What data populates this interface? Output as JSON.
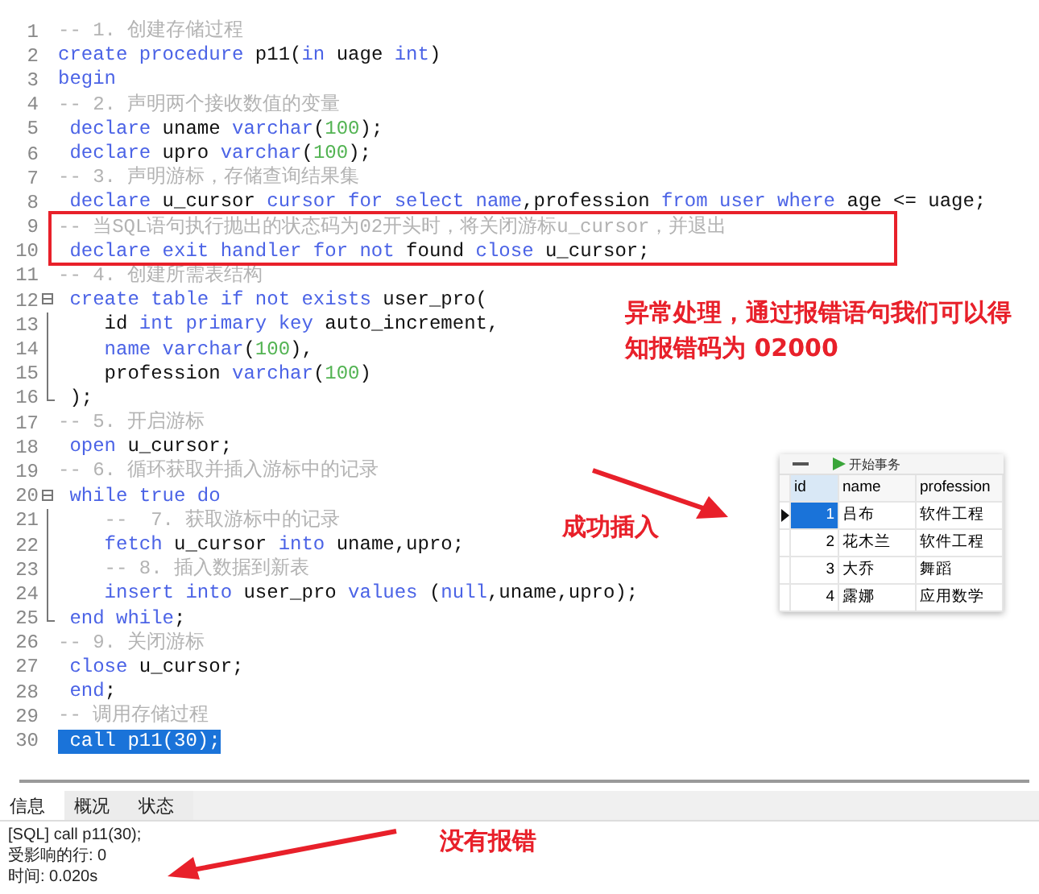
{
  "editor": {
    "lines": [
      {
        "number": "1",
        "selected": false,
        "tokens": [
          {
            "kind": "comment",
            "text": "-- 1. 创建存储过程"
          }
        ]
      },
      {
        "number": "2",
        "selected": false,
        "tokens": [
          {
            "kind": "keyword",
            "text": "create procedure"
          },
          {
            "kind": "plain",
            "text": " p11("
          },
          {
            "kind": "keyword",
            "text": "in"
          },
          {
            "kind": "plain",
            "text": " uage "
          },
          {
            "kind": "keyword",
            "text": "int"
          },
          {
            "kind": "plain",
            "text": ")"
          }
        ]
      },
      {
        "number": "3",
        "selected": false,
        "tokens": [
          {
            "kind": "keyword",
            "text": "begin"
          }
        ]
      },
      {
        "number": "4",
        "selected": false,
        "tokens": [
          {
            "kind": "comment",
            "text": "-- 2. 声明两个接收数值的变量"
          }
        ]
      },
      {
        "number": "5",
        "selected": false,
        "tokens": [
          {
            "kind": "keyword",
            "text": " declare"
          },
          {
            "kind": "plain",
            "text": " uname "
          },
          {
            "kind": "keyword",
            "text": "varchar"
          },
          {
            "kind": "plain",
            "text": "("
          },
          {
            "kind": "number",
            "text": "100"
          },
          {
            "kind": "plain",
            "text": ");"
          }
        ]
      },
      {
        "number": "6",
        "selected": false,
        "tokens": [
          {
            "kind": "keyword",
            "text": " declare"
          },
          {
            "kind": "plain",
            "text": " upro "
          },
          {
            "kind": "keyword",
            "text": "varchar"
          },
          {
            "kind": "plain",
            "text": "("
          },
          {
            "kind": "number",
            "text": "100"
          },
          {
            "kind": "plain",
            "text": ");"
          }
        ]
      },
      {
        "number": "7",
        "selected": false,
        "tokens": [
          {
            "kind": "comment",
            "text": "-- 3. 声明游标，存储查询结果集"
          }
        ]
      },
      {
        "number": "8",
        "selected": false,
        "tokens": [
          {
            "kind": "keyword",
            "text": " declare"
          },
          {
            "kind": "plain",
            "text": " u_cursor "
          },
          {
            "kind": "keyword",
            "text": "cursor for select name"
          },
          {
            "kind": "plain",
            "text": ",profession "
          },
          {
            "kind": "keyword",
            "text": "from user where"
          },
          {
            "kind": "plain",
            "text": " age <= uage;"
          }
        ]
      },
      {
        "number": "9",
        "selected": false,
        "tokens": [
          {
            "kind": "comment",
            "text": "-- 当SQL语句执行抛出的状态码为02开头时，将关闭游标u_cursor，并退出"
          }
        ]
      },
      {
        "number": "10",
        "selected": false,
        "tokens": [
          {
            "kind": "keyword",
            "text": " declare exit handler for not"
          },
          {
            "kind": "plain",
            "text": " found "
          },
          {
            "kind": "keyword",
            "text": "close"
          },
          {
            "kind": "plain",
            "text": " u_cursor;"
          }
        ]
      },
      {
        "number": "11",
        "selected": false,
        "tokens": [
          {
            "kind": "comment",
            "text": "-- 4. 创建所需表结构"
          }
        ]
      },
      {
        "number": "12",
        "fold_start": true,
        "selected": false,
        "tokens": [
          {
            "kind": "keyword",
            "text": " create table if not exists"
          },
          {
            "kind": "plain",
            "text": " user_pro("
          }
        ]
      },
      {
        "number": "13",
        "fold_body": true,
        "selected": false,
        "tokens": [
          {
            "kind": "plain",
            "text": "    id "
          },
          {
            "kind": "keyword",
            "text": "int primary key"
          },
          {
            "kind": "plain",
            "text": " auto_increment,"
          }
        ]
      },
      {
        "number": "14",
        "fold_body": true,
        "selected": false,
        "tokens": [
          {
            "kind": "keyword",
            "text": "    name varchar"
          },
          {
            "kind": "plain",
            "text": "("
          },
          {
            "kind": "number",
            "text": "100"
          },
          {
            "kind": "plain",
            "text": "),"
          }
        ]
      },
      {
        "number": "15",
        "fold_body": true,
        "selected": false,
        "tokens": [
          {
            "kind": "plain",
            "text": "    profession "
          },
          {
            "kind": "keyword",
            "text": "varchar"
          },
          {
            "kind": "plain",
            "text": "("
          },
          {
            "kind": "number",
            "text": "100"
          },
          {
            "kind": "plain",
            "text": ")"
          }
        ]
      },
      {
        "number": "16",
        "fold_end": true,
        "selected": false,
        "tokens": [
          {
            "kind": "plain",
            "text": " );"
          }
        ]
      },
      {
        "number": "17",
        "selected": false,
        "tokens": [
          {
            "kind": "comment",
            "text": "-- 5. 开启游标"
          }
        ]
      },
      {
        "number": "18",
        "selected": false,
        "tokens": [
          {
            "kind": "keyword",
            "text": " open"
          },
          {
            "kind": "plain",
            "text": " u_cursor;"
          }
        ]
      },
      {
        "number": "19",
        "selected": false,
        "tokens": [
          {
            "kind": "comment",
            "text": "-- 6. 循环获取并插入游标中的记录"
          }
        ]
      },
      {
        "number": "20",
        "fold_start": true,
        "selected": false,
        "tokens": [
          {
            "kind": "keyword",
            "text": " while true do"
          }
        ]
      },
      {
        "number": "21",
        "fold_body": true,
        "selected": false,
        "tokens": [
          {
            "kind": "comment",
            "text": "    --  7. 获取游标中的记录"
          }
        ]
      },
      {
        "number": "22",
        "fold_body": true,
        "selected": false,
        "tokens": [
          {
            "kind": "keyword",
            "text": "    fetch"
          },
          {
            "kind": "plain",
            "text": " u_cursor "
          },
          {
            "kind": "keyword",
            "text": "into"
          },
          {
            "kind": "plain",
            "text": " uname,upro;"
          }
        ]
      },
      {
        "number": "23",
        "fold_body": true,
        "selected": false,
        "tokens": [
          {
            "kind": "comment",
            "text": "    -- 8. 插入数据到新表"
          }
        ]
      },
      {
        "number": "24",
        "fold_body": true,
        "selected": false,
        "tokens": [
          {
            "kind": "keyword",
            "text": "    insert into"
          },
          {
            "kind": "plain",
            "text": " user_pro "
          },
          {
            "kind": "keyword",
            "text": "values"
          },
          {
            "kind": "plain",
            "text": " ("
          },
          {
            "kind": "keyword",
            "text": "null"
          },
          {
            "kind": "plain",
            "text": ",uname,upro);"
          }
        ]
      },
      {
        "number": "25",
        "fold_end": true,
        "selected": false,
        "tokens": [
          {
            "kind": "keyword",
            "text": " end while"
          },
          {
            "kind": "plain",
            "text": ";"
          }
        ]
      },
      {
        "number": "26",
        "selected": false,
        "tokens": [
          {
            "kind": "comment",
            "text": "-- 9. 关闭游标"
          }
        ]
      },
      {
        "number": "27",
        "selected": false,
        "tokens": [
          {
            "kind": "keyword",
            "text": " close"
          },
          {
            "kind": "plain",
            "text": " u_cursor;"
          }
        ]
      },
      {
        "number": "28",
        "selected": false,
        "tokens": [
          {
            "kind": "keyword",
            "text": " end"
          },
          {
            "kind": "plain",
            "text": ";"
          }
        ]
      },
      {
        "number": "29",
        "selected": false,
        "tokens": [
          {
            "kind": "comment",
            "text": "-- 调用存储过程"
          }
        ]
      },
      {
        "number": "30",
        "selected": true,
        "tokens": [
          {
            "kind": "plain",
            "text": " call p11(30);"
          }
        ]
      }
    ]
  },
  "annotations": [
    {
      "text": "异常处理，通过报错语句我们可以得知报错码为  02000"
    },
    {
      "text": "成功插入"
    },
    {
      "text": "没有报错"
    }
  ],
  "result_table": {
    "toolbar_button": "开始事务",
    "columns": [
      "id",
      "name",
      "profession"
    ],
    "rows": [
      {
        "selected": true,
        "cells": [
          "1",
          "吕布",
          "软件工程"
        ]
      },
      {
        "selected": false,
        "cells": [
          "2",
          "花木兰",
          "软件工程"
        ]
      },
      {
        "selected": false,
        "cells": [
          "3",
          "大乔",
          "舞蹈"
        ]
      },
      {
        "selected": false,
        "cells": [
          "4",
          "露娜",
          "应用数学"
        ]
      }
    ]
  },
  "bottom_panel": {
    "tabs": [
      {
        "label": "信息",
        "selected": true
      },
      {
        "label": "概况",
        "selected": false
      },
      {
        "label": "状态",
        "selected": false
      }
    ],
    "messages": [
      "[SQL] call p11(30);",
      "受影响的行: 0",
      "时间: 0.020s"
    ]
  }
}
